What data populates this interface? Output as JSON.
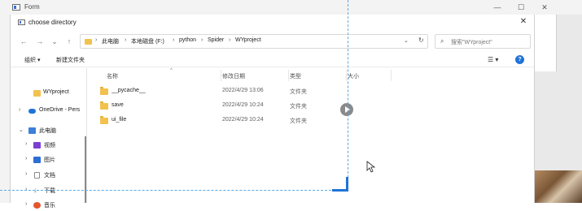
{
  "form": {
    "title": "Form",
    "minimize": "—",
    "maximize": "☐",
    "close": "✕"
  },
  "dialog": {
    "title": "choose directory",
    "close": "✕"
  },
  "nav": {
    "back": "←",
    "forward": "→",
    "dropdown": "⌄",
    "up": "↑"
  },
  "address": {
    "segments": [
      "此电脑",
      "本地磁盘 (F:)",
      "python",
      "Spider",
      "WYproject"
    ],
    "separator": "›",
    "dropdown": "⌄",
    "refresh": "↻"
  },
  "search": {
    "icon": "⌕",
    "placeholder": "搜索\"WYproject\""
  },
  "toolbar": {
    "organize": "组织 ▾",
    "new_folder": "新建文件夹",
    "view": "☰ ▾",
    "help": "?"
  },
  "sidebar": {
    "items": [
      {
        "label": "WYproject",
        "chevron": "",
        "icon": "folder-icon",
        "color": "#f2c14e"
      },
      {
        "label": "OneDrive - Pers",
        "chevron": "›",
        "icon": "cloud-icon",
        "color": "#1f73d8"
      },
      {
        "label": "此电脑",
        "chevron": "⌄",
        "icon": "computer-icon",
        "color": "#3d7fd9"
      },
      {
        "label": "视频",
        "chevron": "›",
        "icon": "video-icon",
        "color": "#7a3fd1"
      },
      {
        "label": "图片",
        "chevron": "›",
        "icon": "pictures-icon",
        "color": "#2c6ed6"
      },
      {
        "label": "文档",
        "chevron": "›",
        "icon": "documents-icon",
        "color": "#8a8a8a"
      },
      {
        "label": "下载",
        "chevron": "›",
        "icon": "downloads-icon",
        "color": "#1f8ad6"
      },
      {
        "label": "音乐",
        "chevron": "›",
        "icon": "music-icon",
        "color": "#e2572c"
      }
    ]
  },
  "columns": {
    "name": "名称",
    "modified": "修改日期",
    "type": "类型",
    "size": "大小",
    "sort": "^"
  },
  "files": [
    {
      "name": "__pycache__",
      "modified": "2022/4/29 13:06",
      "type": "文件夹"
    },
    {
      "name": "save",
      "modified": "2022/4/29 10:24",
      "type": "文件夹"
    },
    {
      "name": "ui_file",
      "modified": "2022/4/29 10:24",
      "type": "文件夹"
    }
  ]
}
